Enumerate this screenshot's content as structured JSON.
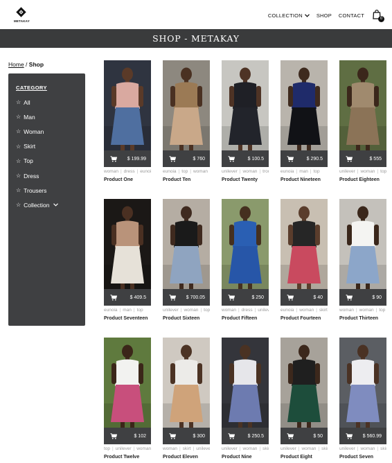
{
  "brand": {
    "name": "METAKAY"
  },
  "nav": {
    "collection": "COLLECTION",
    "shop": "SHOP",
    "contact": "CONTACT",
    "cart_count": "0"
  },
  "banner": {
    "title": "SHOP - METAKAY"
  },
  "breadcrumb": {
    "home": "Home",
    "separator": " / ",
    "current": "Shop"
  },
  "sidebar": {
    "title": "CATEGORY",
    "items": [
      "All",
      "Man",
      "Woman",
      "Skirt",
      "Top",
      "Dress",
      "Trousers",
      "Collection"
    ]
  },
  "products": [
    {
      "name": "Product One",
      "price": "$ 199.99",
      "tags": [
        "woman",
        "dress",
        "eunoia"
      ],
      "colors": {
        "bg": "#2f3440",
        "top": "#d9a9a0",
        "bottom": "#4f6fa0",
        "skin": "#5a3a28"
      }
    },
    {
      "name": "Product Ten",
      "price": "$ 760",
      "tags": [
        "eunoia",
        "top",
        "woman"
      ],
      "colors": {
        "bg": "#8d887f",
        "top": "#9b7a55",
        "bottom": "#c9a889",
        "skin": "#4a3122"
      }
    },
    {
      "name": "Product Twenty",
      "price": "$ 100.5",
      "tags": [
        "unilever",
        "woman",
        "trousers"
      ],
      "colors": {
        "bg": "#c7c6c1",
        "top": "#1f2026",
        "bottom": "#22242b",
        "skin": "#4e3325"
      }
    },
    {
      "name": "Product Nineteen",
      "price": "$ 290.5",
      "tags": [
        "eunoia",
        "man",
        "top"
      ],
      "colors": {
        "bg": "#b9b4ac",
        "top": "#1f2b6a",
        "bottom": "#111216",
        "skin": "#3e2a1e"
      }
    },
    {
      "name": "Product Eighteen",
      "price": "$ 555",
      "tags": [
        "unilever",
        "woman",
        "top"
      ],
      "colors": {
        "bg": "#5f6e43",
        "top": "#a08a6e",
        "bottom": "#8b7357",
        "skin": "#3b271b"
      }
    },
    {
      "name": "Product Seventeen",
      "price": "$ 409.5",
      "tags": [
        "eunoia",
        "man",
        "top"
      ],
      "colors": {
        "bg": "#1b1816",
        "top": "#b9937a",
        "bottom": "#e6e1d8",
        "skin": "#4a3022"
      }
    },
    {
      "name": "Product Sixteen",
      "price": "$ 700.05",
      "tags": [
        "unilever",
        "woman",
        "top"
      ],
      "colors": {
        "bg": "#b5ada3",
        "top": "#1a1a1a",
        "bottom": "#8fa4c0",
        "skin": "#3f2a1f"
      }
    },
    {
      "name": "Product Fifteen",
      "price": "$ 250",
      "tags": [
        "woman",
        "dress",
        "unilever"
      ],
      "colors": {
        "bg": "#8a9a6c",
        "top": "#2a5fb3",
        "bottom": "#2756a8",
        "skin": "#45301f"
      }
    },
    {
      "name": "Product Fourteen",
      "price": "$ 40",
      "tags": [
        "eunoia",
        "woman",
        "skirt"
      ],
      "colors": {
        "bg": "#c8bfb2",
        "top": "#262626",
        "bottom": "#c94a5f",
        "skin": "#5a3d2c"
      }
    },
    {
      "name": "Product Thirteen",
      "price": "$ 90",
      "tags": [
        "woman",
        "woman",
        "top"
      ],
      "colors": {
        "bg": "#c4c1bb",
        "top": "#f4f4f2",
        "bottom": "#8ca6c9",
        "skin": "#3a271b"
      }
    },
    {
      "name": "Product Twelve",
      "price": "$ 102",
      "tags": [
        "top",
        "unilever",
        "woman"
      ],
      "colors": {
        "bg": "#5f7a3e",
        "top": "#f2f2f0",
        "bottom": "#c84f7c",
        "skin": "#3b2619"
      }
    },
    {
      "name": "Product Eleven",
      "price": "$ 300",
      "tags": [
        "woman",
        "skirt",
        "unilever"
      ],
      "colors": {
        "bg": "#cfc9c1",
        "top": "#ecebe8",
        "bottom": "#cfa37a",
        "skin": "#4c3324"
      }
    },
    {
      "name": "Product Nine",
      "price": "$ 250.5",
      "tags": [
        "unilever",
        "woman",
        "skirt"
      ],
      "colors": {
        "bg": "#34353b",
        "top": "#e6e6ea",
        "bottom": "#6d7bb0",
        "skin": "#4a3223"
      }
    },
    {
      "name": "Product Eight",
      "price": "$ 50",
      "tags": [
        "unilever",
        "woman",
        "skirt"
      ],
      "colors": {
        "bg": "#a7a29a",
        "top": "#1f1f1f",
        "bottom": "#1d4d3b",
        "skin": "#3c281c"
      }
    },
    {
      "name": "Product Seven",
      "price": "$ 560.99",
      "tags": [
        "unilever",
        "woman",
        "skirt"
      ],
      "colors": {
        "bg": "#5b5e63",
        "top": "#ededf0",
        "bottom": "#7f8cbf",
        "skin": "#4a3224"
      }
    }
  ]
}
